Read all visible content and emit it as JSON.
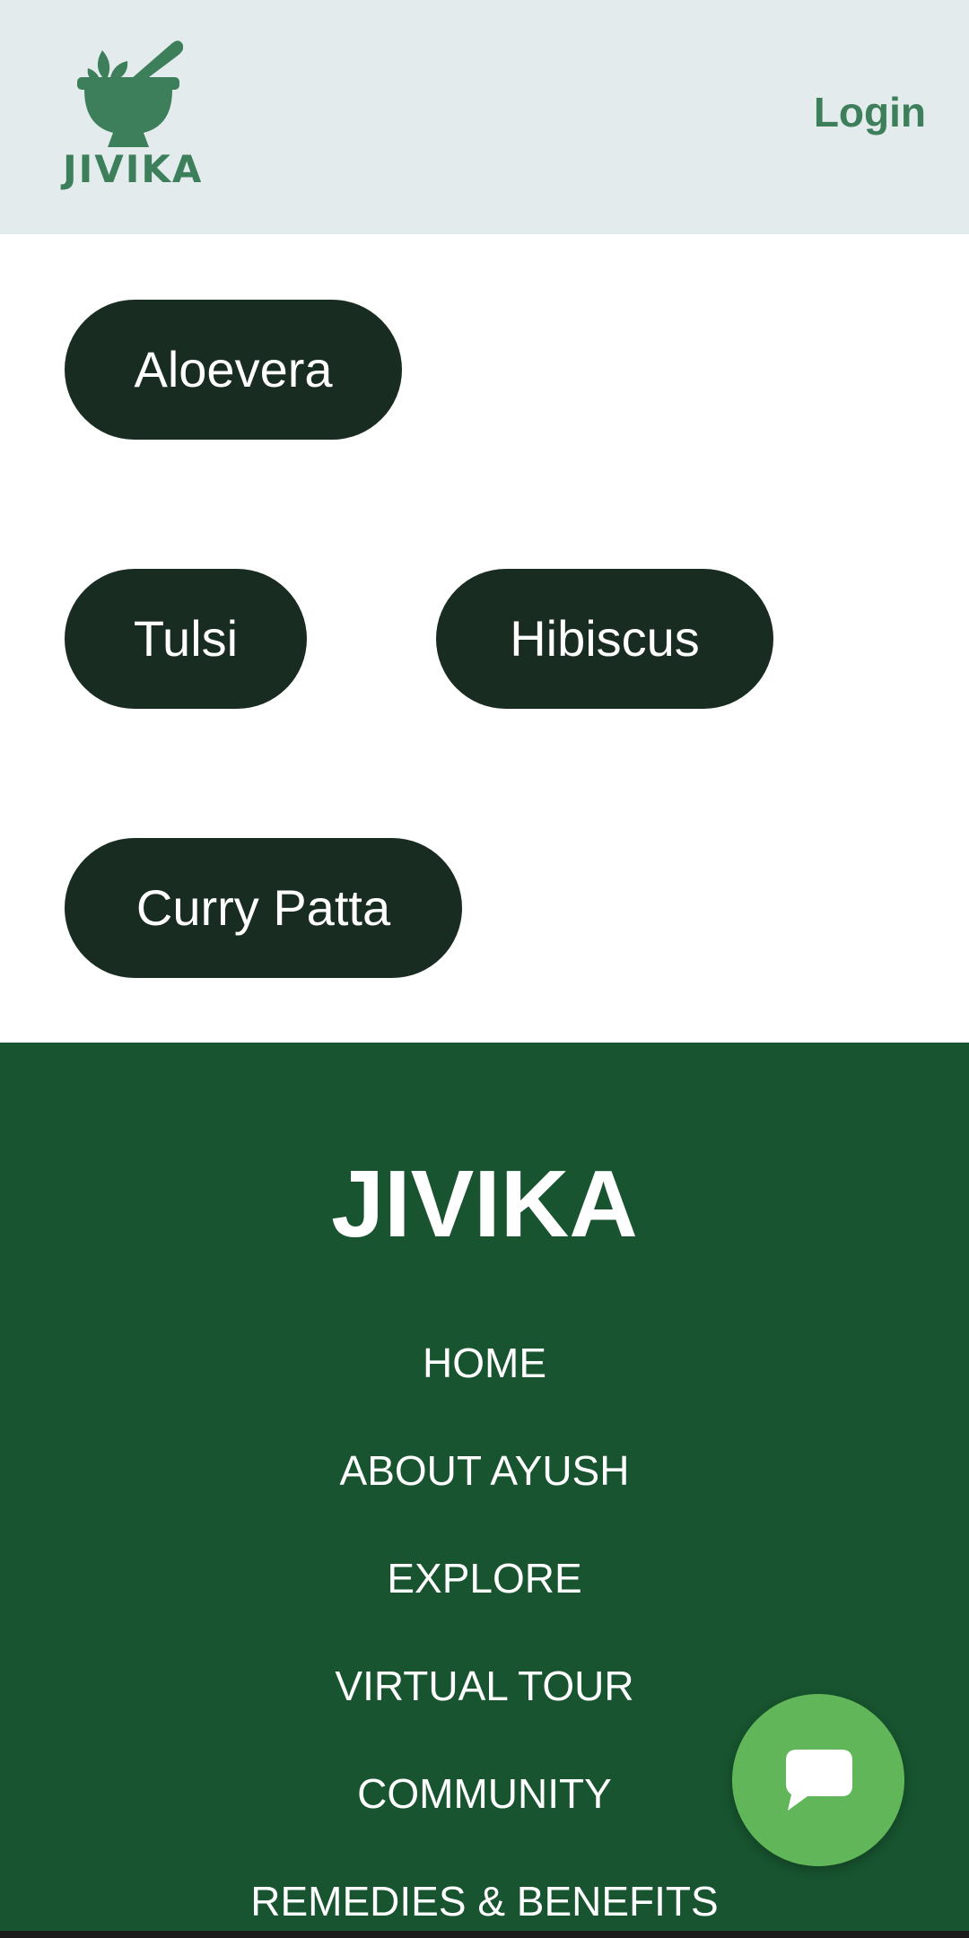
{
  "header": {
    "logo_text": "JIVIKA",
    "login_label": "Login"
  },
  "chips": [
    {
      "label": "Aloevera"
    },
    {
      "label": "Tulsi"
    },
    {
      "label": "Hibiscus"
    },
    {
      "label": "Curry Patta"
    }
  ],
  "footer": {
    "brand": "JIVIKA",
    "links": [
      {
        "label": "HOME"
      },
      {
        "label": "ABOUT AYUSH"
      },
      {
        "label": "EXPLORE"
      },
      {
        "label": "VIRTUAL TOUR"
      },
      {
        "label": "COMMUNITY"
      },
      {
        "label": "REMEDIES & BENEFITS"
      }
    ]
  },
  "colors": {
    "header_bg": "#e3ebed",
    "brand_green": "#3d7f5a",
    "chip_bg": "#192c22",
    "footer_bg": "#17542f",
    "fab_bg": "#62b65a"
  },
  "icons": {
    "logo": "mortar-pestle-leaf-icon",
    "chat": "chat-bubble-icon"
  }
}
